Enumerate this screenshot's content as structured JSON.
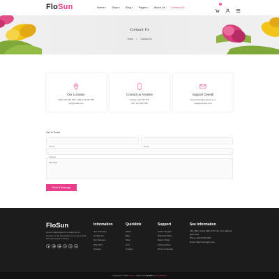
{
  "header": {
    "logo_main": "Flo",
    "logo_accent": "Sun",
    "nav": [
      {
        "label": "Home",
        "caret": "▾"
      },
      {
        "label": "Shop",
        "caret": "▾"
      },
      {
        "label": "Blog",
        "caret": "▾"
      },
      {
        "label": "Pages",
        "caret": "▾"
      },
      {
        "label": "About Us",
        "caret": ""
      },
      {
        "label": "Contact Us",
        "caret": ""
      }
    ],
    "cart_count": "0",
    "icons": [
      "cart-icon",
      "user-icon",
      "menu-icon"
    ]
  },
  "banner": {
    "title": "Contact Us",
    "crumb_home": "Home",
    "crumb_sep": ">",
    "crumb_current": "Contact Us"
  },
  "cards": [
    {
      "icon": "location-pin-icon",
      "title": "Our Location",
      "lines": [
        "(360) 123 456 789 | (360) 123 456 789",
        "info@email.com"
      ]
    },
    {
      "icon": "mobile-icon",
      "title": "Contact us Anytime",
      "lines": [
        "Mobile: 012 345 678",
        "Fax: 123 456 789"
      ]
    },
    {
      "icon": "envelope-icon",
      "title": "Support Overall",
      "lines": [
        "Support24/7@example.com",
        "info@example.com"
      ]
    }
  ],
  "form": {
    "title": "Get In Touch",
    "name_placeholder": "Name",
    "email_placeholder": "Email",
    "subject_placeholder": "Subject",
    "message_placeholder": "Message",
    "submit_label": "Send A Message"
  },
  "footer": {
    "logo": "FloSun",
    "description": "Lorem Khaled Ipsum is a major key to success. To be successful you've got to work hard you've got to make it.",
    "socials": [
      "facebook-icon",
      "twitter-icon",
      "youtube-icon",
      "google-plus-icon",
      "instagram-icon",
      "linkedin-icon"
    ],
    "columns": [
      {
        "title": "Information",
        "links": [
          "Our Company",
          "Contact Us",
          "Our Services",
          "Why We?",
          "Careers"
        ]
      },
      {
        "title": "Quicklink",
        "links": [
          "About",
          "Blog",
          "Shop",
          "Cart",
          "Contact"
        ]
      },
      {
        "title": "Support",
        "links": [
          "Online Support",
          "Shipping Policy",
          "Return Policy",
          "Privacy Policy",
          "Terms of Service"
        ]
      },
      {
        "title": "See Information",
        "links": [
          "123, ABC, Road, DEF XYZ City, Your address goes here.",
          "Phone: 01234 567 890",
          "Email: https://example.com"
        ]
      }
    ],
    "copyright_pre": "Copyright © 2022",
    "copyright_brand": "FloSun",
    "copyright_mid": "| Built with",
    "copyright_theme": "FloSun",
    "copyright_by": "by",
    "copyright_author": "Thedesigns"
  },
  "colors": {
    "accent": "#e83e8c",
    "footer_bg": "#1c1c1c",
    "banner_bg": "#ececec"
  }
}
